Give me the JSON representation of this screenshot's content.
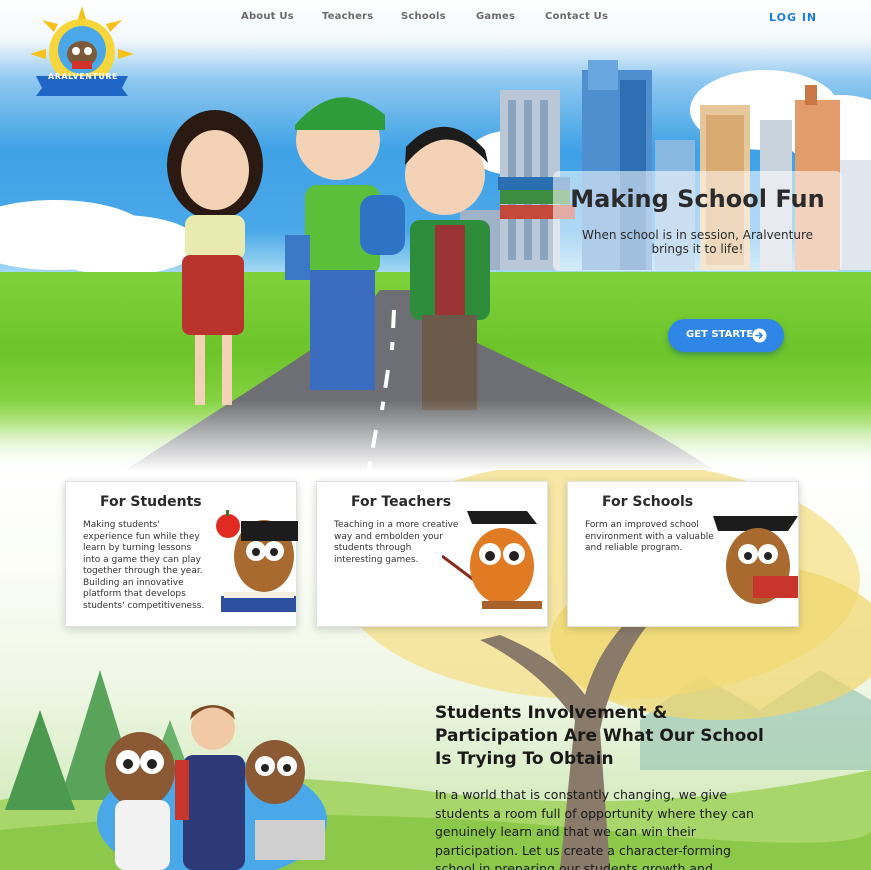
{
  "brand": {
    "name": "ARALVENTURE"
  },
  "nav": {
    "items": [
      {
        "label": "About Us"
      },
      {
        "label": "Teachers"
      },
      {
        "label": "Schools"
      },
      {
        "label": "Games"
      },
      {
        "label": "Contact Us"
      }
    ],
    "login_label": "LOG IN"
  },
  "hero": {
    "title": "Making School Fun",
    "subtitle": "When school is in session, Aralventure brings it to life!",
    "cta_label": "GET STARTED"
  },
  "cards": [
    {
      "title": "For Students",
      "text": "Making students' experience fun while they learn by turning lessons into a game they can play together through the year. Building an innovative platform that develops students' competitiveness."
    },
    {
      "title": "For Teachers",
      "text": "Teaching in a more creative way and embolden your students through interesting games."
    },
    {
      "title": "For Schools",
      "text": "Form an improved school environment with a valuable and reliable program."
    }
  ],
  "section": {
    "title": "Students Involvement & Participation Are What Our School Is Trying To Obtain",
    "body": "In a world that is constantly changing, we give students a room full of opportunity where they can genuinely learn and that we can win their participation. Let us create a character-forming school in preparing our students growth and"
  },
  "colors": {
    "accent": "#2f86e6",
    "login": "#1c7be0",
    "sky": "#3fa2e6",
    "grass": "#6cc42a"
  }
}
